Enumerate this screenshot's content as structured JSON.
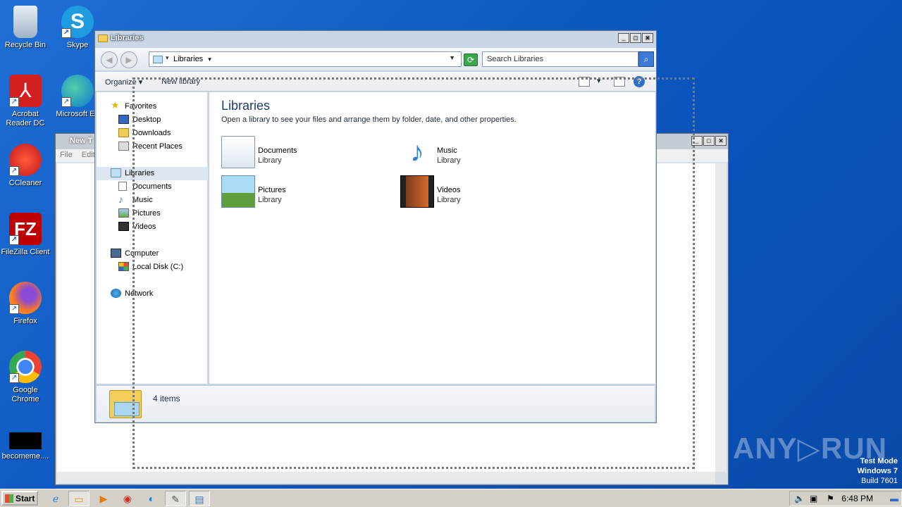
{
  "desktop": {
    "icons": [
      {
        "label": "Recycle Bin"
      },
      {
        "label": "Skype"
      },
      {
        "label": "Acrobat Reader DC"
      },
      {
        "label": "Microsoft Ed"
      },
      {
        "label": "CCleaner"
      },
      {
        "label": "FileZilla Client"
      },
      {
        "label": "Firefox"
      },
      {
        "label": "Google Chrome"
      },
      {
        "label": "becomeme...."
      }
    ],
    "watermark": "ANY▷RUN",
    "test_mode": {
      "line1": "Test Mode",
      "line2": "Windows 7",
      "line3": "Build 7601"
    }
  },
  "notepad": {
    "title": "New T",
    "menu": {
      "file": "File",
      "edit": "Edit"
    }
  },
  "explorer": {
    "title": "Libraries",
    "address": {
      "crumb": "Libraries"
    },
    "search": {
      "placeholder": "Search Libraries"
    },
    "toolbar": {
      "organize": "Organize",
      "new_library": "New library"
    },
    "nav": {
      "favorites": "Favorites",
      "desktop": "Desktop",
      "downloads": "Downloads",
      "recent": "Recent Places",
      "libraries": "Libraries",
      "documents": "Documents",
      "music": "Music",
      "pictures": "Pictures",
      "videos": "Videos",
      "computer": "Computer",
      "local_disk": "Local Disk (C:)",
      "network": "Network"
    },
    "content": {
      "heading": "Libraries",
      "description": "Open a library to see your files and arrange them by folder, date, and other properties.",
      "tiles": [
        {
          "name": "Documents",
          "type": "Library"
        },
        {
          "name": "Music",
          "type": "Library"
        },
        {
          "name": "Pictures",
          "type": "Library"
        },
        {
          "name": "Videos",
          "type": "Library"
        }
      ]
    },
    "details": {
      "count": "4 items"
    }
  },
  "taskbar": {
    "start": "Start",
    "clock": "6:48 PM"
  }
}
